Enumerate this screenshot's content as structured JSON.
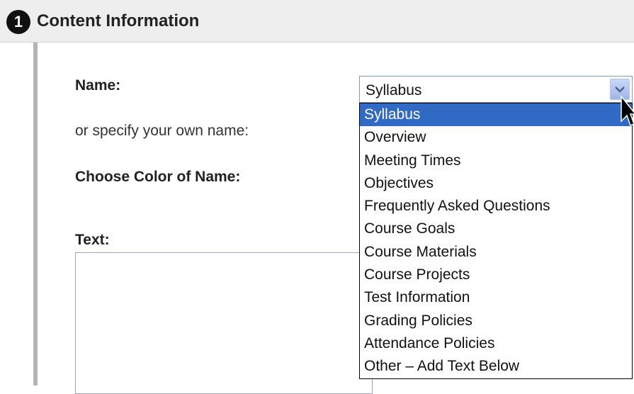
{
  "header": {
    "step_number": "1",
    "title": "Content Information"
  },
  "form": {
    "name_label": "Name:",
    "own_name_label": "or specify your own name:",
    "color_label": "Choose Color of Name:",
    "text_label": "Text:"
  },
  "name_select": {
    "value": "Syllabus",
    "arrow_icon": "chevron-down-icon",
    "options": [
      {
        "label": "Syllabus",
        "selected": true
      },
      {
        "label": "Overview",
        "selected": false
      },
      {
        "label": "Meeting Times",
        "selected": false
      },
      {
        "label": "Objectives",
        "selected": false
      },
      {
        "label": "Frequently Asked Questions",
        "selected": false
      },
      {
        "label": "Course Goals",
        "selected": false
      },
      {
        "label": "Course Materials",
        "selected": false
      },
      {
        "label": "Course Projects",
        "selected": false
      },
      {
        "label": "Test Information",
        "selected": false
      },
      {
        "label": "Grading Policies",
        "selected": false
      },
      {
        "label": "Attendance Policies",
        "selected": false
      },
      {
        "label": "Other – Add Text Below",
        "selected": false
      }
    ]
  },
  "colors": {
    "header_bg": "#eeeeee",
    "selection_bg": "#316ac5",
    "selection_text": "#ffffff",
    "rule": "#b5b5b5"
  }
}
